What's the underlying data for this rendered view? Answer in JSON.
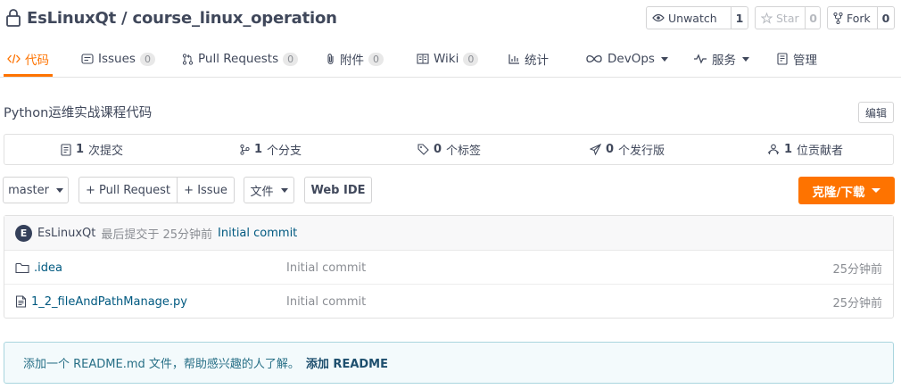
{
  "header": {
    "repo_name": "EsLinuxQt / course_linux_operation",
    "lock_icon": "lock-icon",
    "watch": {
      "label": "Unwatch",
      "count": "1",
      "icon": "eye-icon"
    },
    "star": {
      "label": "Star",
      "count": "0",
      "icon": "star-icon"
    },
    "fork": {
      "label": "Fork",
      "count": "0",
      "icon": "fork-icon"
    }
  },
  "nav": {
    "code": {
      "label": "代码",
      "icon": "code-icon"
    },
    "issues": {
      "label": "Issues",
      "count": "0",
      "icon": "issues-icon"
    },
    "pull_requests": {
      "label": "Pull Requests",
      "count": "0",
      "icon": "pull-request-icon"
    },
    "attachments": {
      "label": "附件",
      "count": "0",
      "icon": "paperclip-icon"
    },
    "wiki": {
      "label": "Wiki",
      "count": "0",
      "icon": "wiki-icon"
    },
    "stats": {
      "label": "统计",
      "icon": "bar-chart-icon"
    },
    "devops": {
      "label": "DevOps",
      "icon": "infinity-icon"
    },
    "services": {
      "label": "服务",
      "icon": "pulse-icon"
    },
    "manage": {
      "label": "管理",
      "icon": "settings-doc-icon"
    }
  },
  "description": {
    "text": "Python运维实战课程代码",
    "edit_label": "编辑"
  },
  "stats_bar": {
    "commits": {
      "count": "1",
      "label": "次提交"
    },
    "branches": {
      "count": "1",
      "label": "个分支"
    },
    "tags": {
      "count": "0",
      "label": "个标签"
    },
    "releases": {
      "count": "0",
      "label": "个发行版"
    },
    "contributors": {
      "count": "1",
      "label": "位贡献者"
    }
  },
  "toolbar": {
    "branch": "master",
    "pull_request": "+ Pull Request",
    "issue": "+ Issue",
    "file_menu": "文件",
    "web_ide": "Web IDE",
    "clone": "克隆/下载"
  },
  "latest_commit": {
    "avatar_letter": "E",
    "author": "EsLinuxQt",
    "meta": "最后提交于 25分钟前",
    "message": "Initial commit"
  },
  "files": [
    {
      "name": ".idea",
      "type": "folder",
      "message": "Initial commit",
      "time": "25分钟前"
    },
    {
      "name": "1_2_fileAndPathManage.py",
      "type": "file",
      "message": "Initial commit",
      "time": "25分钟前"
    }
  ],
  "readme_notice": {
    "text": "添加一个 README.md 文件，帮助感兴趣的人了解。",
    "link": "添加 README"
  },
  "colors": {
    "accent": "#fe7300",
    "text": "#40485b",
    "link": "#005980",
    "muted": "#8a8d93",
    "notice_bg": "#f3fafc",
    "notice_border": "#a9d5de"
  }
}
